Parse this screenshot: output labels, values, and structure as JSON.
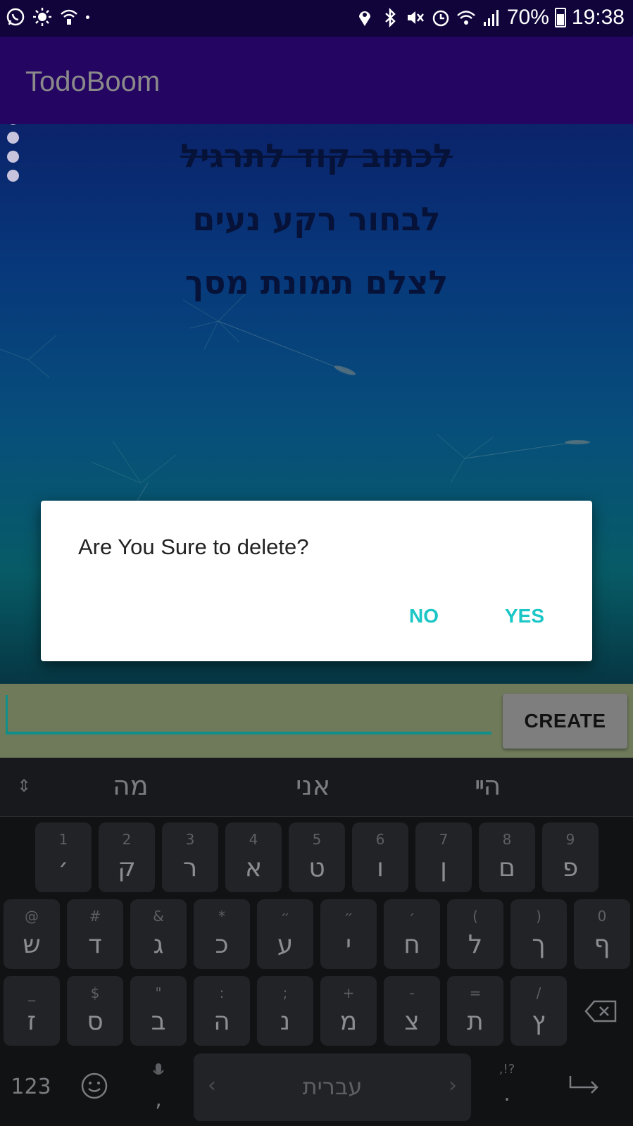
{
  "status_bar": {
    "icons_left": [
      "whatsapp-icon",
      "brightness-icon",
      "wifi-call-icon",
      "dot-icon"
    ],
    "icons_right": [
      "location-icon",
      "bluetooth-icon",
      "mute-icon",
      "alarm-icon",
      "wifi-icon",
      "signal-icon"
    ],
    "battery": "70%",
    "battery_level": 0.7,
    "time": "19:38"
  },
  "app_bar": {
    "title": "TodoBoom"
  },
  "todos": [
    {
      "text": "לכתוב קוד לתרגיל",
      "done": true
    },
    {
      "text": "לבחור רקע נעים",
      "done": false
    },
    {
      "text": "לצלם תמונת מסך",
      "done": false
    }
  ],
  "input": {
    "value": "",
    "placeholder": ""
  },
  "create_button": {
    "label": "CREATE"
  },
  "dialog": {
    "message": "Are You Sure to delete?",
    "no_label": "NO",
    "yes_label": "YES",
    "accent_color": "#1ac6c6"
  },
  "keyboard": {
    "suggestions": [
      "הײ",
      "אני",
      "מה"
    ],
    "row1": [
      {
        "top": "1",
        "main": "׳"
      },
      {
        "top": "2",
        "main": "ק"
      },
      {
        "top": "3",
        "main": "ר"
      },
      {
        "top": "4",
        "main": "א"
      },
      {
        "top": "5",
        "main": "ט"
      },
      {
        "top": "6",
        "main": "ו"
      },
      {
        "top": "7",
        "main": "ן"
      },
      {
        "top": "8",
        "main": "ם"
      },
      {
        "top": "9",
        "main": "פ"
      }
    ],
    "row2": [
      {
        "top": "@",
        "main": "ש"
      },
      {
        "top": "#",
        "main": "ד"
      },
      {
        "top": "&",
        "main": "ג"
      },
      {
        "top": "*",
        "main": "כ"
      },
      {
        "top": "״",
        "main": "ע"
      },
      {
        "top": "״",
        "main": "י"
      },
      {
        "top": "׳",
        "main": "ח"
      },
      {
        "top": "(",
        "main": "ל"
      },
      {
        "top": ")",
        "main": "ך"
      },
      {
        "top": "0",
        "main": "ף"
      }
    ],
    "row3": [
      {
        "top": "_",
        "main": "ז"
      },
      {
        "top": "$",
        "main": "ס"
      },
      {
        "top": "\"",
        "main": "ב"
      },
      {
        "top": ":",
        "main": "ה"
      },
      {
        "top": ";",
        "main": "נ"
      },
      {
        "top": "+",
        "main": "מ"
      },
      {
        "top": "-",
        "main": "צ"
      },
      {
        "top": "=",
        "main": "ת"
      },
      {
        "top": "/",
        "main": "ץ"
      }
    ],
    "bottom": {
      "numbers_label": "123",
      "comma": ",",
      "space_label": "עברית",
      "punct_top": ",!?",
      "period": "."
    }
  }
}
